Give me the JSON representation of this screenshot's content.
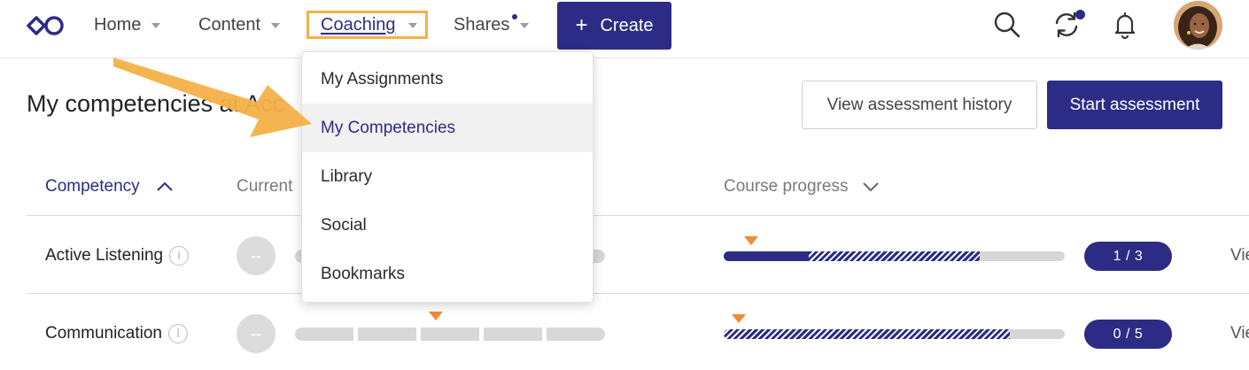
{
  "nav": {
    "home": "Home",
    "content": "Content",
    "coaching": "Coaching",
    "shares": "Shares",
    "create": "Create",
    "create_plus": "+"
  },
  "page": {
    "title": "My competencies at Acc",
    "view_history": "View assessment history",
    "start_assessment": "Start assessment"
  },
  "table": {
    "headers": {
      "competency": "Competency",
      "current": "Current",
      "course_progress": "Course progress"
    },
    "rows": [
      {
        "name": "Active Listening",
        "info": "i",
        "level": "--",
        "progress_solid_fraction": 0.25,
        "progress_hatched_fraction": 0.5,
        "progress_label": "1 / 3",
        "link": "Vie"
      },
      {
        "name": "Communication",
        "info": "i",
        "level": "--",
        "progress_solid_fraction": 0,
        "progress_hatched_fraction": 0.84,
        "progress_label": "0 / 5",
        "link": "Vie"
      }
    ]
  },
  "menu": {
    "items": [
      {
        "label": "My Assignments",
        "active": false
      },
      {
        "label": "My Competencies",
        "active": true
      },
      {
        "label": "Library",
        "active": false
      },
      {
        "label": "Social",
        "active": false
      },
      {
        "label": "Bookmarks",
        "active": false
      }
    ]
  },
  "colors": {
    "brand": "#2c2c86",
    "highlight": "#f4b24a",
    "marker": "#f08a36",
    "arrow": "#f4b24a"
  },
  "icons": [
    "logo-icon",
    "search-icon",
    "sync-icon",
    "bell-icon",
    "avatar",
    "chevron-up-icon",
    "chevron-down-icon",
    "info-icon"
  ]
}
